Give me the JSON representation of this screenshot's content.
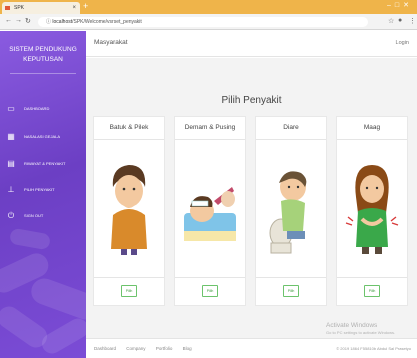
{
  "browser": {
    "tab_title": "SPK",
    "new_tab": "+",
    "url_host": "localhost",
    "url_path": "/SPK/Welcome/vsrset_penyakit"
  },
  "sidebar": {
    "brand_line1": "SISTEM PENDUKUNG",
    "brand_line2": "KEPUTUSAN",
    "items": [
      {
        "label": "Dashboard",
        "icon": "monitor-icon"
      },
      {
        "label": "Nasalasi Gejala",
        "icon": "chart-icon"
      },
      {
        "label": "Riwayat & Penyakit",
        "icon": "document-icon"
      },
      {
        "label": "Pilih Penyakit",
        "icon": "thermometer-icon"
      },
      {
        "label": "Sign Out",
        "icon": "logout-icon"
      }
    ]
  },
  "topbar": {
    "title": "Masyarakat",
    "login": "Login"
  },
  "main": {
    "heading": "Pilih Penyakit",
    "cards": [
      {
        "name": "Batuk & Pilek",
        "button": "Pilih"
      },
      {
        "name": "Demam & Pusing",
        "button": "Pilih"
      },
      {
        "name": "Diare",
        "button": "Pilih"
      },
      {
        "name": "Maag",
        "button": "Pilih"
      }
    ]
  },
  "footer": {
    "links": [
      "Dashboard",
      "Company",
      "Portfolio",
      "Blog"
    ],
    "copyright": "© 2019 1864 F55810b Abdul Sal Prasetyo"
  },
  "watermark": {
    "line1": "Activate Windows",
    "line2": "Go to PC settings to activate Windows."
  },
  "colors": {
    "sidebar": "#7b4cd6",
    "tabbar": "#efb44a",
    "button_green": "#6cc36c"
  }
}
